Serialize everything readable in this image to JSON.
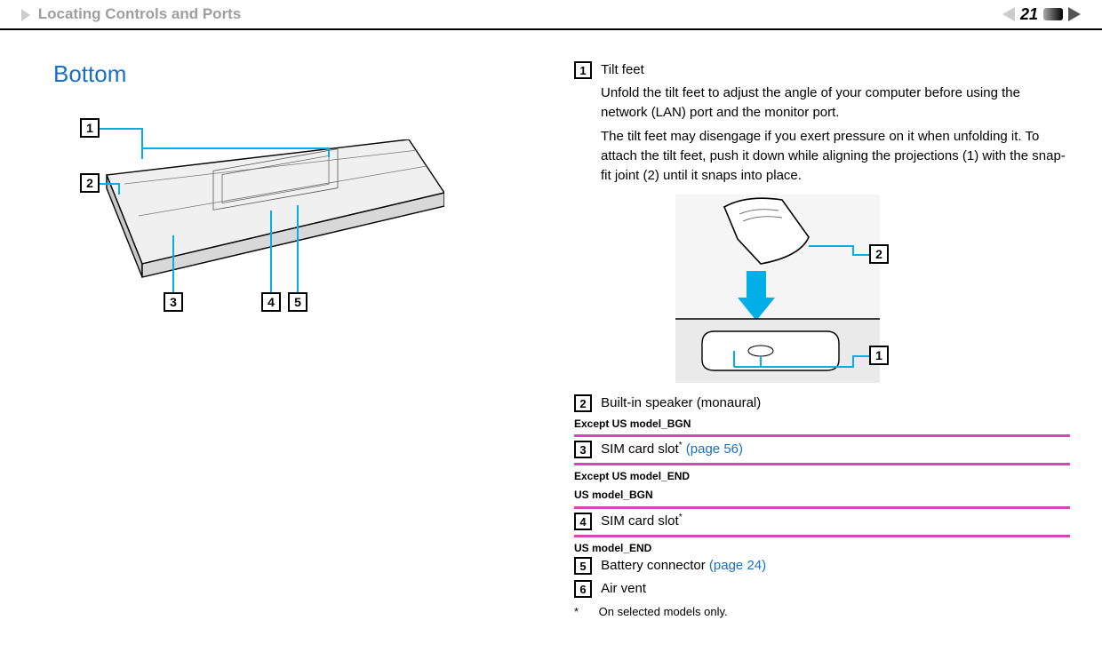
{
  "header": {
    "breadcrumb": "Locating Controls and Ports",
    "pageNumber": "21"
  },
  "sectionTitle": "Bottom",
  "mainDiagram": {
    "callouts": {
      "c1": "1",
      "c2": "2",
      "c3": "3",
      "c4": "4",
      "c5": "5"
    }
  },
  "tiltDiagram": {
    "callouts": {
      "c1": "1",
      "c2": "2"
    }
  },
  "items": {
    "i1": {
      "num": "1",
      "label": "Tilt feet",
      "desc1": "Unfold the tilt feet to adjust the angle of your computer before using the network (LAN) port and the monitor port.",
      "desc2": "The tilt feet may disengage if you exert pressure on it when unfolding it. To attach the tilt feet, push it down while aligning the projections (1) with the snap-fit joint (2) until it snaps into place."
    },
    "i2": {
      "num": "2",
      "label": "Built-in speaker (monaural)"
    },
    "tagExceptUSBgn": "Except US model_BGN",
    "i3": {
      "num": "3",
      "label": "SIM card slot",
      "sup": "*",
      "link": " (page 56)"
    },
    "tagExceptUSEnd": "Except US model_END",
    "tagUSBgn": "US model_BGN",
    "i4": {
      "num": "4",
      "label": "SIM card slot",
      "sup": "*"
    },
    "tagUSEnd": "US model_END",
    "i5": {
      "num": "5",
      "label": "Battery connector ",
      "link": "(page 24)"
    },
    "i6": {
      "num": "6",
      "label": "Air vent"
    },
    "footnote": {
      "ast": "*",
      "text": "On selected models only."
    }
  }
}
